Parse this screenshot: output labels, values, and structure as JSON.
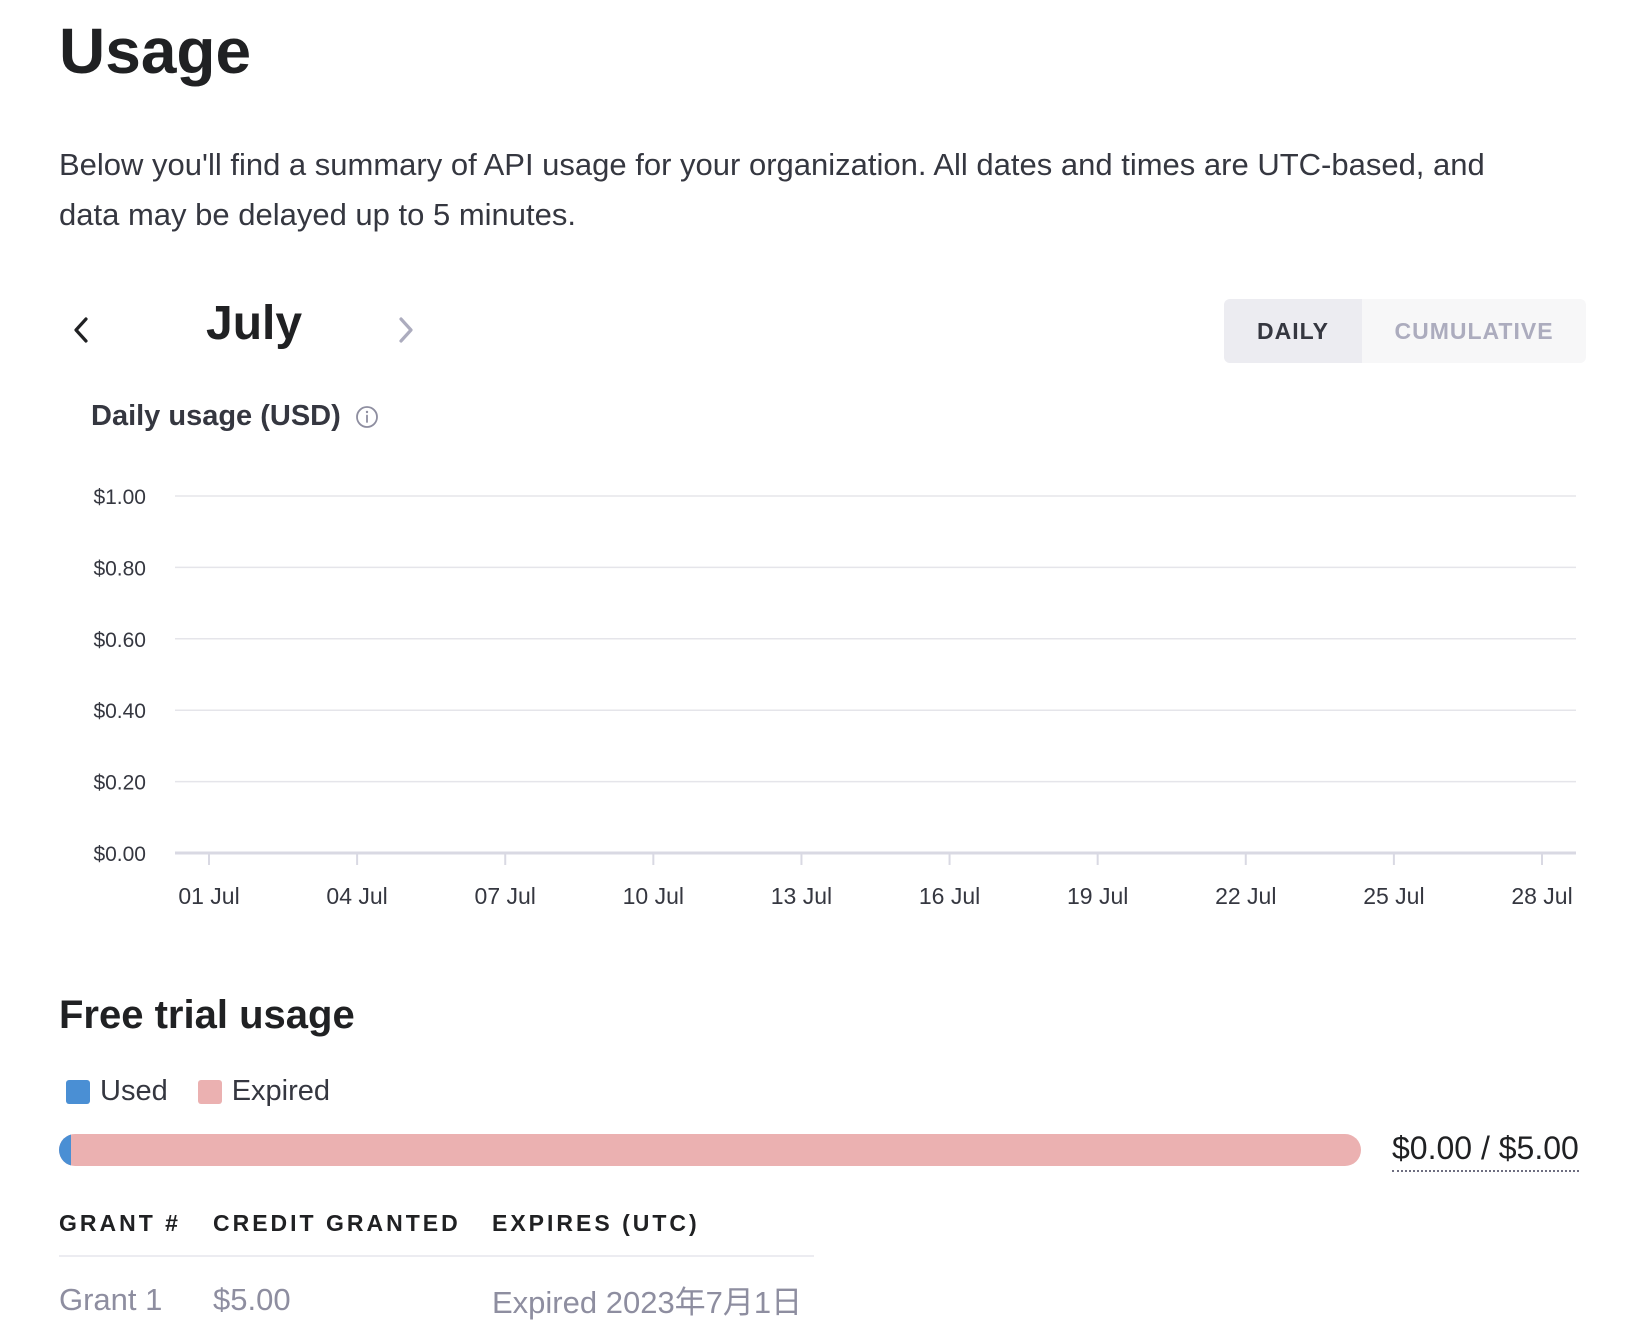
{
  "page": {
    "title": "Usage",
    "intro": "Below you'll find a summary of API usage for your organization. All dates and times are UTC-based, and data may be delayed up to 5 minutes."
  },
  "month_nav": {
    "month": "July",
    "prev_icon": "chevron-left-icon",
    "next_icon": "chevron-right-icon"
  },
  "view_toggle": {
    "daily_label": "DAILY",
    "cumulative_label": "CUMULATIVE",
    "selected": "DAILY"
  },
  "chart": {
    "title": "Daily usage (USD)",
    "info_icon": "info-icon"
  },
  "chart_data": {
    "type": "bar",
    "title": "Daily usage (USD)",
    "xlabel": "",
    "ylabel": "",
    "x_tick_labels": [
      "01 Jul",
      "04 Jul",
      "07 Jul",
      "10 Jul",
      "13 Jul",
      "16 Jul",
      "19 Jul",
      "22 Jul",
      "25 Jul",
      "28 Jul"
    ],
    "y_tick_labels": [
      "$0.00",
      "$0.20",
      "$0.40",
      "$0.60",
      "$0.80",
      "$1.00"
    ],
    "y_ticks": [
      0,
      0.2,
      0.4,
      0.6,
      0.8,
      1.0
    ],
    "ylim": [
      0,
      1.0
    ],
    "grid": true,
    "series": [
      {
        "values": []
      }
    ]
  },
  "free_trial": {
    "title": "Free trial usage",
    "legend": [
      {
        "label": "Used",
        "color": "#4a8fd4"
      },
      {
        "label": "Expired",
        "color": "#ebb1b1"
      }
    ],
    "used_amount": 0.0,
    "total_amount": 5.0,
    "usage_text": "$0.00 / $5.00"
  },
  "grants": {
    "headers": [
      "GRANT #",
      "CREDIT GRANTED",
      "EXPIRES (UTC)"
    ],
    "rows": [
      [
        "Grant 1",
        "$5.00",
        "Expired 2023年7月1日"
      ]
    ]
  },
  "colors": {
    "used": "#4a8fd4",
    "expired": "#ebb1b1",
    "gridline": "#e5e5ea",
    "axis": "#d9d9e3"
  }
}
